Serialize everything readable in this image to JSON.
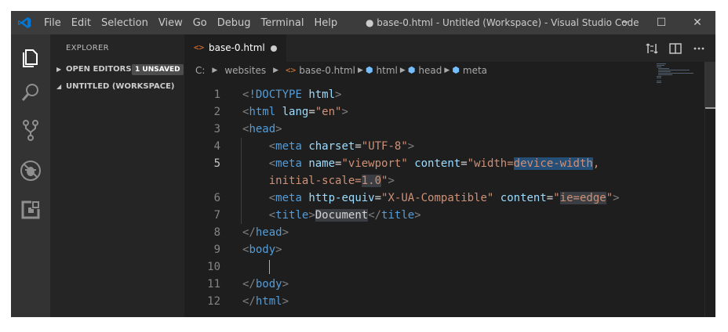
{
  "window": {
    "title": "● base-0.html - Untitled (Workspace) - Visual Studio Code",
    "minimize": "─",
    "maximize": "☐",
    "close": "✕"
  },
  "menu": [
    "File",
    "Edit",
    "Selection",
    "View",
    "Go",
    "Debug",
    "Terminal",
    "Help"
  ],
  "activity_bar": [
    "explorer-icon",
    "search-icon",
    "source-control-icon",
    "debug-icon",
    "extensions-icon"
  ],
  "sidebar": {
    "title": "EXPLORER",
    "open_editors": {
      "label": "OPEN EDITORS",
      "badge": "1 UNSAVED",
      "expanded": false
    },
    "workspace": {
      "label": "UNTITLED (WORKSPACE)",
      "expanded": true
    }
  },
  "tab": {
    "icon": "<>",
    "label": "base-0.html",
    "dirty": true
  },
  "breadcrumbs": {
    "drive": "C:",
    "folder": "websites",
    "file_icon": "<>",
    "file": "base-0.html",
    "html": "html",
    "head": "head",
    "meta": "meta"
  },
  "code": {
    "line_numbers": [
      "1",
      "2",
      "3",
      "4",
      "5",
      "",
      "6",
      "7",
      "8",
      "9",
      "10",
      "11",
      "12"
    ],
    "current_line": "5",
    "lines": [
      [
        [
          "pu",
          "<"
        ],
        [
          "tg",
          "!DOCTYPE"
        ],
        [
          "tx",
          " "
        ],
        [
          "at",
          "html"
        ],
        [
          "pu",
          ">"
        ]
      ],
      [
        [
          "pu",
          "<"
        ],
        [
          "tg",
          "html"
        ],
        [
          "tx",
          " "
        ],
        [
          "at",
          "lang"
        ],
        [
          "tx",
          "="
        ],
        [
          "st",
          "\"en\""
        ],
        [
          "pu",
          ">"
        ]
      ],
      [
        [
          "pu",
          "<"
        ],
        [
          "tg",
          "head"
        ],
        [
          "pu",
          ">"
        ]
      ],
      [
        [
          "tx",
          "    "
        ],
        [
          "pu",
          "<"
        ],
        [
          "tg",
          "meta"
        ],
        [
          "tx",
          " "
        ],
        [
          "at",
          "charset"
        ],
        [
          "tx",
          "="
        ],
        [
          "st",
          "\"UTF-8\""
        ],
        [
          "pu",
          ">"
        ]
      ],
      [
        [
          "tx",
          "    "
        ],
        [
          "pu",
          "<"
        ],
        [
          "tg",
          "meta"
        ],
        [
          "tx",
          " "
        ],
        [
          "at",
          "name"
        ],
        [
          "tx",
          "="
        ],
        [
          "st",
          "\"viewport\""
        ],
        [
          "tx",
          " "
        ],
        [
          "at",
          "content"
        ],
        [
          "tx",
          "="
        ],
        [
          "st",
          "\"width="
        ],
        [
          "st hl2",
          "device-width"
        ],
        [
          "st",
          ","
        ]
      ],
      [
        [
          "st",
          "    initial-scale="
        ],
        [
          "st hl",
          "1.0"
        ],
        [
          "st",
          "\""
        ],
        [
          "pu",
          ">"
        ]
      ],
      [
        [
          "tx",
          "    "
        ],
        [
          "pu",
          "<"
        ],
        [
          "tg",
          "meta"
        ],
        [
          "tx",
          " "
        ],
        [
          "at",
          "http-equiv"
        ],
        [
          "tx",
          "="
        ],
        [
          "st",
          "\"X-UA-Compatible\""
        ],
        [
          "tx",
          " "
        ],
        [
          "at",
          "content"
        ],
        [
          "tx",
          "="
        ],
        [
          "st",
          "\""
        ],
        [
          "st hl",
          "ie=edge"
        ],
        [
          "st",
          "\""
        ],
        [
          "pu",
          ">"
        ]
      ],
      [
        [
          "tx",
          "    "
        ],
        [
          "pu",
          "<"
        ],
        [
          "tg",
          "title"
        ],
        [
          "pu",
          ">"
        ],
        [
          "tx hl",
          "Document"
        ],
        [
          "pu",
          "</"
        ],
        [
          "tg",
          "title"
        ],
        [
          "pu",
          ">"
        ]
      ],
      [
        [
          "pu",
          "</"
        ],
        [
          "tg",
          "head"
        ],
        [
          "pu",
          ">"
        ]
      ],
      [
        [
          "pu",
          "<"
        ],
        [
          "tg",
          "body"
        ],
        [
          "pu",
          ">"
        ]
      ],
      [
        [
          "tx",
          ""
        ]
      ],
      [
        [
          "pu",
          "</"
        ],
        [
          "tg",
          "body"
        ],
        [
          "pu",
          ">"
        ]
      ],
      [
        [
          "pu",
          "</"
        ],
        [
          "tg",
          "html"
        ],
        [
          "pu",
          ">"
        ]
      ]
    ]
  },
  "colors": {
    "titlebar": "#3c3c3c",
    "activity_bar": "#333333",
    "sidebar": "#252526",
    "editor": "#1e1e1e",
    "tag": "#569cd6",
    "attribute": "#9cdcfe",
    "string": "#ce9178",
    "logo": "#0078d7",
    "tab_icon": "#e37933",
    "crumb_icon": "#75beff"
  }
}
